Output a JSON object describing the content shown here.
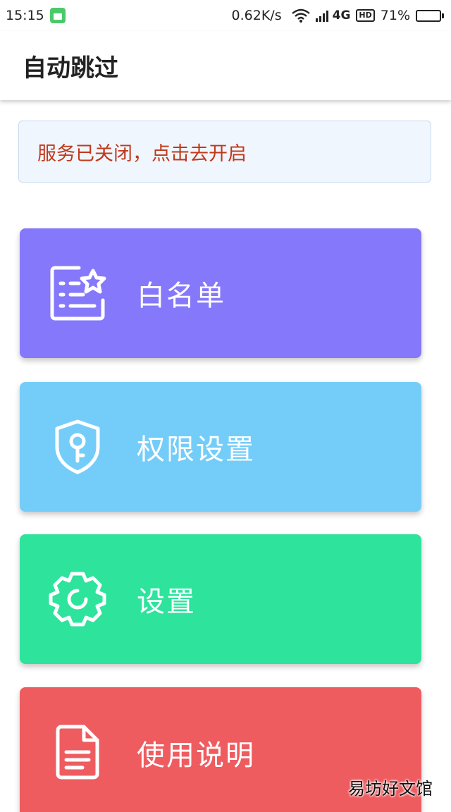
{
  "status_bar": {
    "time": "15:15",
    "network_speed": "0.62K/s",
    "network_type": "4G",
    "hd_label": "HD",
    "battery_percent": "71%",
    "battery_level": 0.71
  },
  "app_bar": {
    "title": "自动跳过"
  },
  "banner": {
    "text": "服务已关闭，点击去开启",
    "text_color": "#c0391b"
  },
  "cards": [
    {
      "label": "白名单",
      "icon": "whitelist-star-icon",
      "color": "#8678fb"
    },
    {
      "label": "权限设置",
      "icon": "shield-key-icon",
      "color": "#74cdf9"
    },
    {
      "label": "设置",
      "icon": "gear-icon",
      "color": "#2ee39c"
    },
    {
      "label": "使用说明",
      "icon": "document-icon",
      "color": "#ee5c60"
    }
  ],
  "watermark": "易坊好文馆"
}
